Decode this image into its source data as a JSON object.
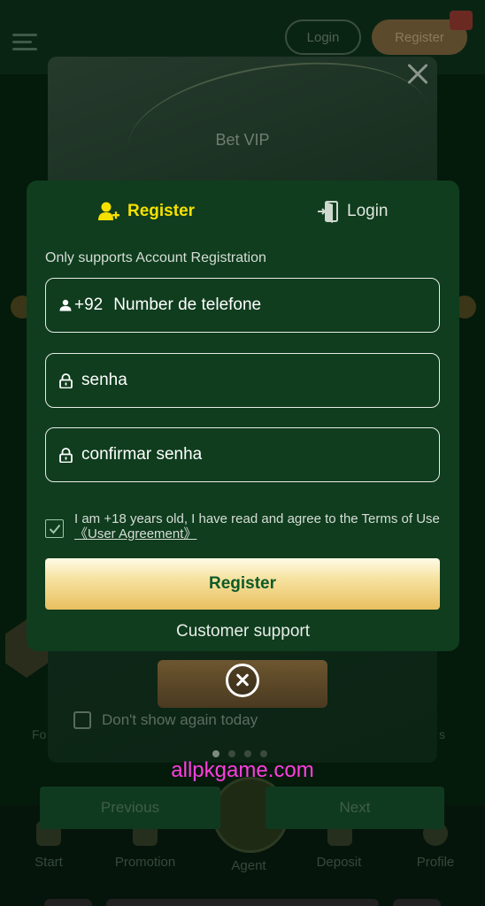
{
  "header": {
    "login_label": "Login",
    "register_label": "Register"
  },
  "popup": {
    "title": "Bet VIP",
    "dont_show_label": "Don't show again today",
    "page_dots": 4,
    "active_dot": 1
  },
  "modal": {
    "tabs": [
      {
        "label": "Register",
        "icon": "add-user-icon",
        "active": true
      },
      {
        "label": "Login",
        "icon": "login-door-icon",
        "active": false
      }
    ],
    "notice": "Only supports Account Registration",
    "phone": {
      "prefix": "+92",
      "placeholder": "Number de telefone",
      "icon": "user-icon"
    },
    "password": {
      "placeholder": "senha",
      "icon": "lock-icon"
    },
    "confirm_password": {
      "placeholder": "confirmar senha",
      "icon": "lock-icon"
    },
    "agreement": {
      "checked": true,
      "text": "I am +18 years old, I have read and agree to the Terms of Use",
      "link": "《User Agreement》"
    },
    "register_button": "Register",
    "customer_support": "Customer support"
  },
  "watermark": "allpkgame.com",
  "pager": {
    "previous": "Previous",
    "next": "Next"
  },
  "bottom_nav": {
    "items": [
      {
        "label": "Start",
        "icon": "home-icon"
      },
      {
        "label": "Promotion",
        "icon": "gift-icon"
      },
      {
        "label": "Agent",
        "icon": "agent-icon"
      },
      {
        "label": "Deposit",
        "icon": "wallet-icon"
      },
      {
        "label": "Profile",
        "icon": "profile-icon"
      }
    ]
  },
  "side_labels": {
    "left": "Fo",
    "right": "s"
  },
  "colors": {
    "accent_yellow": "#f6e000",
    "modal_bg": "#0f3d1e",
    "button_gold": "#e9bf5f",
    "button_text_green": "#0d5a28",
    "watermark_pink": "#ff3ee0"
  }
}
